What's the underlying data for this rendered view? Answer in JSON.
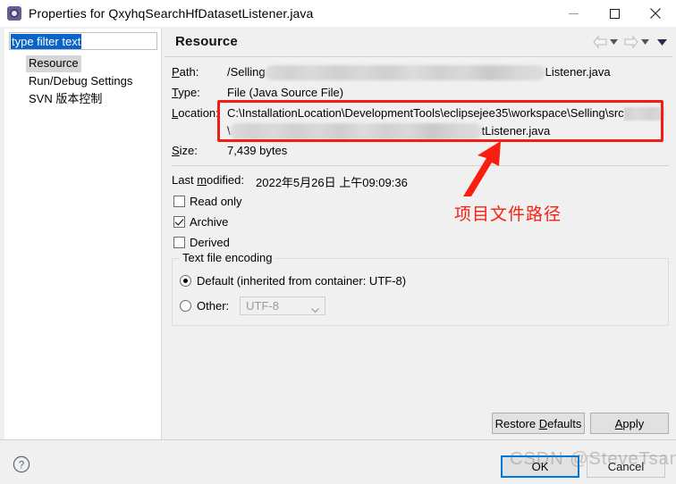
{
  "window": {
    "title": "Properties for QxyhqSearchHfDatasetListener.java",
    "icon": "properties-gear-icon",
    "minimize_label": "Minimize",
    "maximize_label": "Maximize",
    "close_label": "Close"
  },
  "sidebar": {
    "filter": {
      "value": "type filter text",
      "placeholder": "type filter text"
    },
    "items": [
      {
        "label": "Resource",
        "selected": true
      },
      {
        "label": "Run/Debug Settings",
        "selected": false
      },
      {
        "label": "SVN 版本控制",
        "selected": false
      }
    ]
  },
  "page": {
    "title": "Resource",
    "nav": {
      "back_icon": "back-arrow-icon",
      "back_menu_icon": "chevron-down-icon",
      "forward_icon": "forward-arrow-icon",
      "forward_menu_icon": "chevron-down-icon",
      "view_menu_icon": "chevron-down-icon"
    },
    "fields": [
      {
        "label": "Path:",
        "accel": "P",
        "value_prefix": "/Selling",
        "value_suffix": "Listener.java",
        "redacted": true
      },
      {
        "label": "Type:",
        "accel": "T",
        "value_prefix": "File  (Java Source File)",
        "value_suffix": "",
        "redacted": false
      },
      {
        "label": "Location:",
        "accel": "L",
        "value_prefix": "C:\\InstallationLocation\\DevelopmentTools\\eclipsejee35\\workspace\\Selling\\src",
        "value_suffix": "",
        "redacted": true
      },
      {
        "label": "Size:",
        "accel": "S",
        "value_prefix": "7,439  bytes",
        "value_suffix": "",
        "redacted": false
      }
    ],
    "location_line2_prefix": "\\",
    "location_line2_suffix": "tListener.java",
    "last_modified": {
      "label_pre": "Last ",
      "label_accel": "m",
      "label_post": "odified:",
      "value": "2022年5月26日 上午09:09:36"
    },
    "checkboxes": [
      {
        "label_pre": "",
        "accel": "R",
        "label_post": "ead only",
        "checked": false
      },
      {
        "label_pre": "",
        "accel": "A",
        "label_post": "rchive",
        "checked": true
      },
      {
        "label_pre": "Deri",
        "accel": "v",
        "label_post": "ed",
        "checked": false
      }
    ],
    "encoding_group": {
      "legend_pre": "",
      "legend_accel": "T",
      "legend_post": "ext file encoding",
      "default_option": {
        "label": "Default (inherited from container: UTF-8)",
        "selected": true
      },
      "other_option": {
        "label_pre": "",
        "accel": "O",
        "label_post": "ther:",
        "selected": false,
        "combo_value": "UTF-8",
        "combo_disabled": true
      }
    }
  },
  "annotation": {
    "text": "项目文件路径",
    "color": "#fb1e10",
    "arrow_icon": "red-arrow-icon",
    "highlight_box_color": "#f01e14"
  },
  "footer": {
    "help_icon": "help-circle-icon",
    "restore_defaults": {
      "pre": "Restore ",
      "accel": "D",
      "post": "efaults"
    },
    "apply": {
      "pre": "",
      "accel": "A",
      "post": "pply"
    },
    "ok": {
      "label": "OK",
      "focused": true
    },
    "cancel": {
      "label": "Cancel",
      "focused": false
    }
  },
  "watermark": {
    "text": "CSDN @SteveTsang"
  }
}
